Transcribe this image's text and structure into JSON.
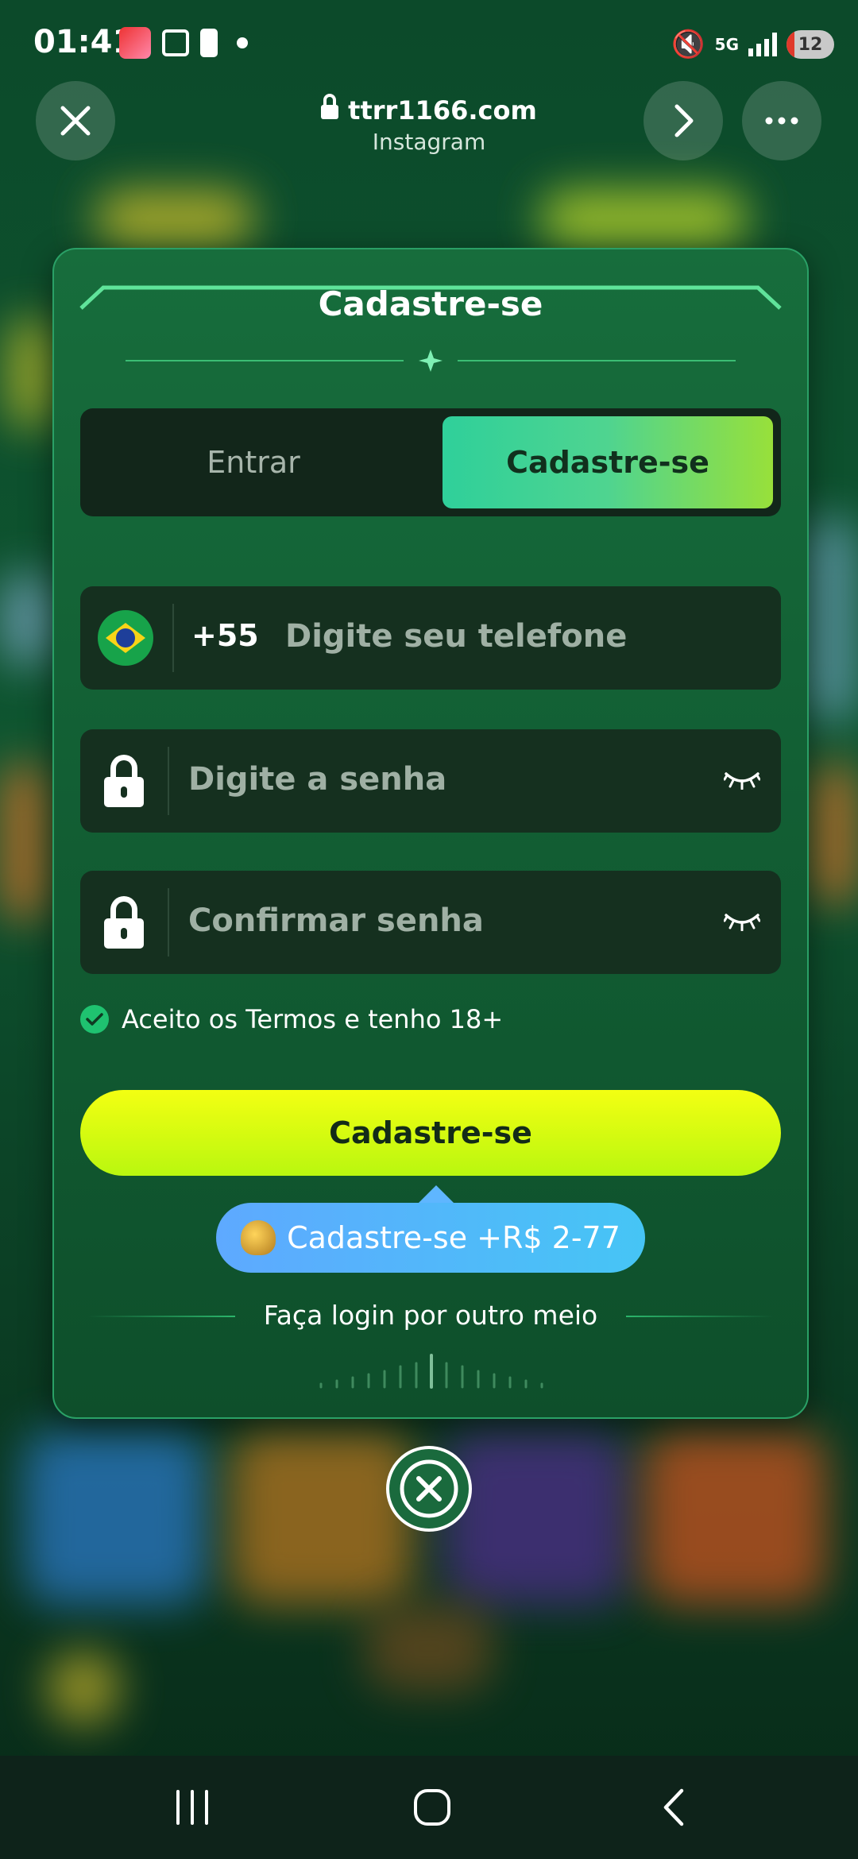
{
  "status_bar": {
    "time": "01:41",
    "network": "5G",
    "battery": "12"
  },
  "browser": {
    "url": "ttrr1166.com",
    "source": "Instagram",
    "icons": {
      "close": "close-icon",
      "forward": "chevron-right-icon",
      "menu": "more-horizontal-icon",
      "lock": "lock-icon"
    }
  },
  "modal": {
    "title": "Cadastre-se",
    "tabs": [
      {
        "label": "Entrar",
        "active": false
      },
      {
        "label": "Cadastre-se",
        "active": true
      }
    ],
    "phone": {
      "country_code": "+55",
      "placeholder": "Digite seu telefone",
      "flag": "brazil-flag-icon"
    },
    "password": {
      "placeholder": "Digite a senha"
    },
    "confirm_password": {
      "placeholder": "Confirmar senha"
    },
    "terms": {
      "label": "Aceito os Termos e tenho 18+",
      "checked": true
    },
    "submit_label": "Cadastre-se",
    "bonus_label": "Cadastre-se +R$ 2-77",
    "alt_login_label": "Faça login por outro meio"
  },
  "colors": {
    "accent_green": "#2fd09a",
    "submit_yellow": "#f3ff12",
    "bonus_blue": "#5ea9ff",
    "modal_bg": "#176d3c"
  }
}
